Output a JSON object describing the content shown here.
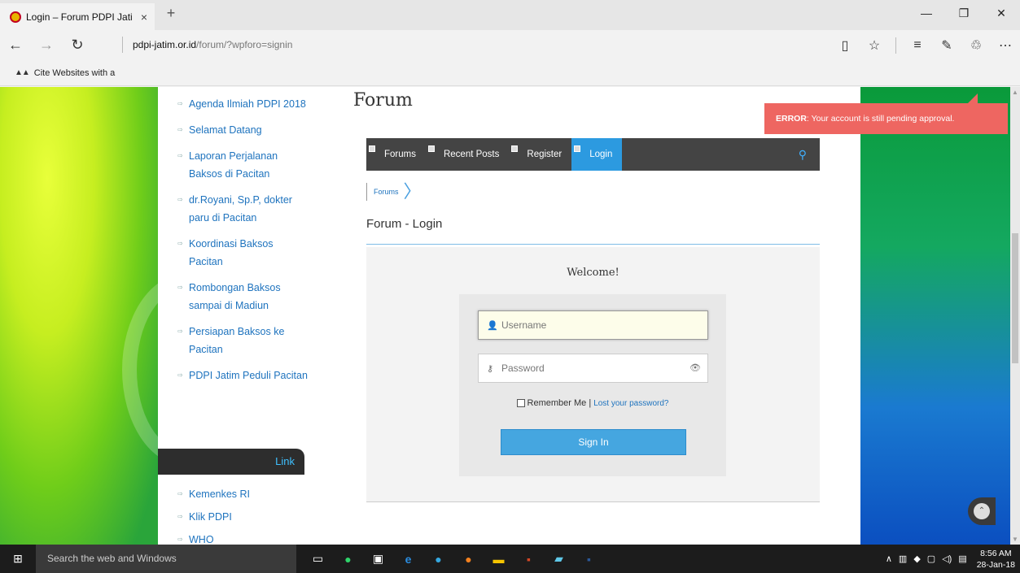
{
  "browser": {
    "tab_title": "Login – Forum PDPI Jati",
    "tab_close": "×",
    "new_tab": "+",
    "address_host": "pdpi-jatim.or.id",
    "address_path": "/forum/?wpforo=signin",
    "favorites": [
      {
        "label": "Cite Websites with a"
      }
    ]
  },
  "sidebar": {
    "posts": [
      "Agenda Ilmiah PDPI 2018",
      "Selamat Datang",
      "Laporan Perjalanan Baksos di Pacitan",
      "dr.Royani, Sp.P, dokter paru di Pacitan",
      "Koordinasi Baksos Pacitan",
      "Rombongan Baksos sampai di Madiun",
      "Persiapan Baksos ke Pacitan",
      "PDPI Jatim Peduli Pacitan"
    ],
    "link_header": "Link",
    "links": [
      "Kemenkes RI",
      "Klik PDPI",
      "WHO"
    ]
  },
  "forum": {
    "heading": "Forum",
    "menu": [
      {
        "label": "Forums",
        "active": false
      },
      {
        "label": "Recent Posts",
        "active": false
      },
      {
        "label": "Register",
        "active": false
      },
      {
        "label": "Login",
        "active": true
      }
    ],
    "breadcrumb": "Forums",
    "page_title": "Forum - Login",
    "welcome": "Welcome!",
    "username_placeholder": "Username",
    "password_placeholder": "Password",
    "remember_label": "Remember Me |",
    "lost_password": "Lost your password?",
    "sign_in": "Sign In"
  },
  "error": {
    "label": "ERROR",
    "message": ": Your account is still pending approval."
  },
  "taskbar": {
    "search_placeholder": "Search the web and Windows",
    "time": "8:56 AM",
    "date": "28-Jan-18"
  },
  "colors": {
    "accent": "#2c9ae0",
    "error": "#ee6661",
    "menu_bg": "#444444"
  }
}
